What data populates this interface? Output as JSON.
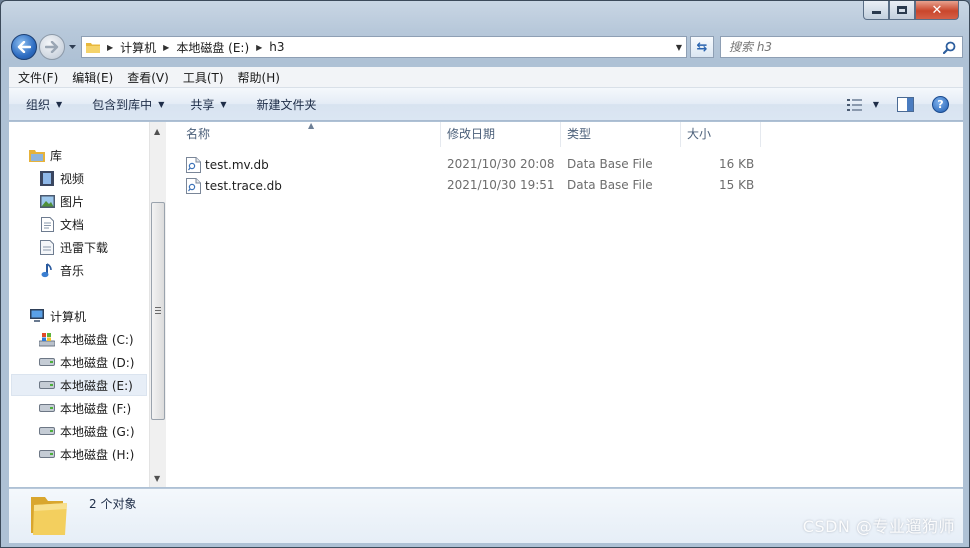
{
  "window": {
    "caption_buttons": [
      "minimize-icon",
      "maximize-icon",
      "close-icon"
    ]
  },
  "address": {
    "crumbs": [
      "计算机",
      "本地磁盘 (E:)",
      "h3"
    ],
    "search_placeholder": "搜索 h3"
  },
  "menu": {
    "items": [
      "文件(F)",
      "编辑(E)",
      "查看(V)",
      "工具(T)",
      "帮助(H)"
    ]
  },
  "toolbar": {
    "organize": "组织",
    "include_in_library": "包含到库中",
    "share": "共享",
    "new_folder": "新建文件夹"
  },
  "nav": {
    "libraries": {
      "label": "库",
      "items": [
        "视频",
        "图片",
        "文档",
        "迅雷下载",
        "音乐"
      ]
    },
    "computer": {
      "label": "计算机",
      "drives": [
        "本地磁盘 (C:)",
        "本地磁盘 (D:)",
        "本地磁盘 (E:)",
        "本地磁盘 (F:)",
        "本地磁盘 (G:)",
        "本地磁盘 (H:)"
      ],
      "selected_drive": "本地磁盘 (E:)"
    }
  },
  "files": {
    "columns": [
      "名称",
      "修改日期",
      "类型",
      "大小"
    ],
    "rows": [
      {
        "name": "test.mv.db",
        "modified": "2021/10/30 20:08",
        "type": "Data Base File",
        "size": "16 KB"
      },
      {
        "name": "test.trace.db",
        "modified": "2021/10/30 19:51",
        "type": "Data Base File",
        "size": "15 KB"
      }
    ]
  },
  "details": {
    "count": "2 个对象"
  },
  "watermark": "CSDN @专业遛狗师",
  "colors": {
    "accent_blue": "#2e6dc2",
    "close_red": "#c9462c",
    "folder_yellow": "#f0c64a"
  }
}
